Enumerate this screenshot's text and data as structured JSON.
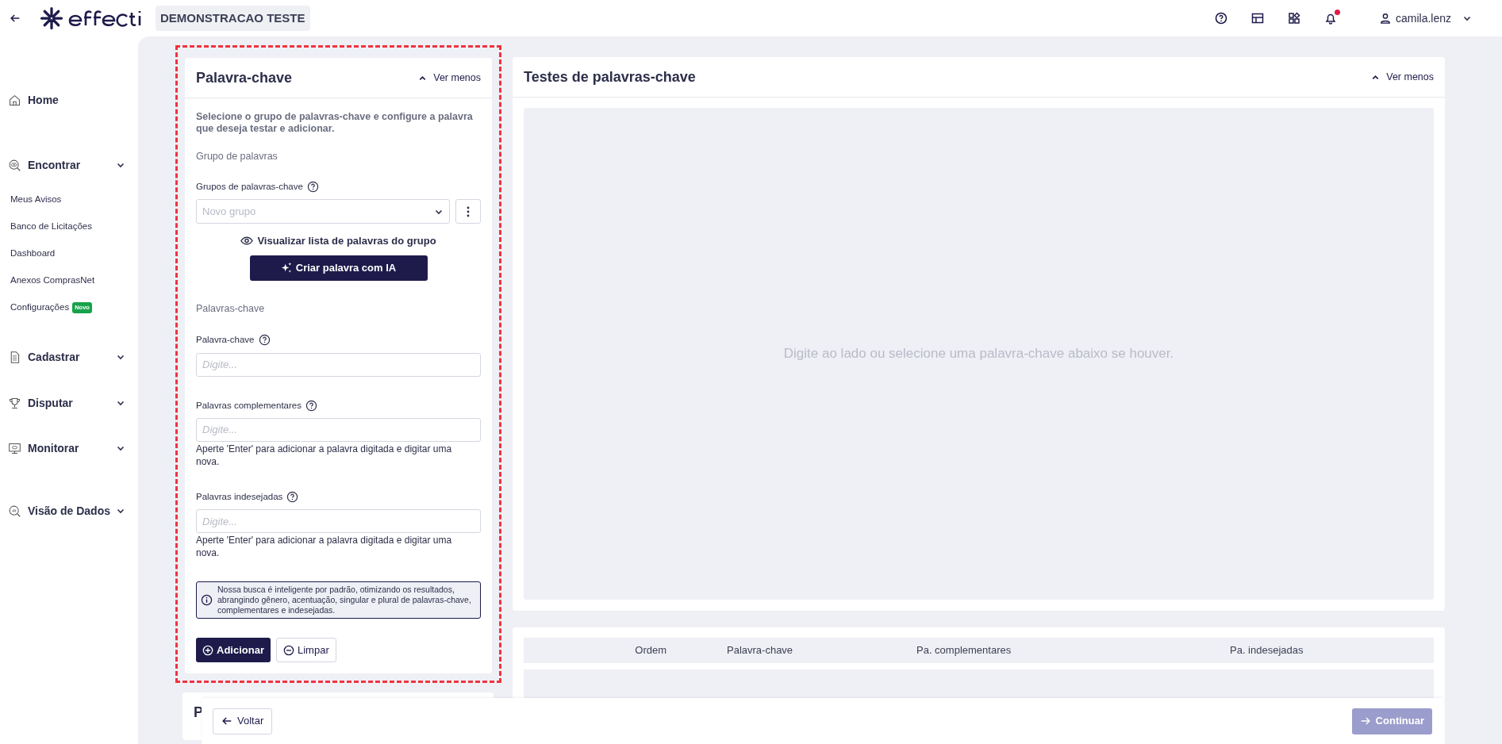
{
  "header": {
    "company": "DEMONSTRACAO TESTE",
    "user": "camila.lenz",
    "notification_dot": true
  },
  "sidebar": {
    "items": [
      {
        "kind": "single",
        "label": "Home"
      },
      {
        "kind": "group",
        "label": "Encontrar"
      },
      {
        "kind": "link",
        "label": "Meus Avisos"
      },
      {
        "kind": "link",
        "label": "Banco de Licitações"
      },
      {
        "kind": "link",
        "label": "Dashboard"
      },
      {
        "kind": "link",
        "label": "Anexos ComprasNet"
      },
      {
        "kind": "link",
        "label": "Configurações",
        "badge": "Novo"
      },
      {
        "kind": "group",
        "label": "Cadastrar"
      },
      {
        "kind": "group",
        "label": "Disputar"
      },
      {
        "kind": "group",
        "label": "Monitorar"
      },
      {
        "kind": "group",
        "label": "Visão de Dados"
      }
    ]
  },
  "keyword_panel": {
    "title": "Palavra-chave",
    "toggle": "Ver menos",
    "description": "Selecione o grupo de palavras-chave e configure a palavra que deseja testar e adicionar.",
    "group_section": "Grupo de palavras",
    "group_label": "Grupos de palavras-chave",
    "group_select": {
      "placeholder": "Novo grupo"
    },
    "view_list_link": "Visualizar lista de palavras do grupo",
    "ai_button": "Criar palavra com IA",
    "keywords_section": "Palavras-chave",
    "fields": [
      {
        "label": "Palavra-chave",
        "placeholder": "Digite..."
      },
      {
        "label": "Palavras complementares",
        "placeholder": "Digite...",
        "hint": "Aperte 'Enter' para adicionar a palavra digitada e digitar uma nova."
      },
      {
        "label": "Palavras indesejadas",
        "placeholder": "Digite...",
        "hint": "Aperte 'Enter' para adicionar a palavra digitada e digitar uma nova."
      }
    ],
    "info": "Nossa busca é inteligente por padrão, otimizando os resultados, abrangindo gênero, acentuação, singular e plural de palavras-chave, complementares e indesejadas.",
    "buttons": [
      "Adicionar",
      "Limpar"
    ]
  },
  "tests_panel": {
    "title": "Testes de palavras-chave",
    "toggle": "Ver menos",
    "empty_text": "Digite ao lado ou selecione uma palavra-chave abaixo se houver."
  },
  "table": {
    "columns": [
      "Ordem",
      "Palavra-chave",
      "Pa. complementares",
      "Pa. indesejadas"
    ]
  },
  "hidden_card": {
    "title": "P"
  },
  "footer": {
    "back": "Voltar",
    "continue": "Continuar",
    "continue_disabled": true
  }
}
